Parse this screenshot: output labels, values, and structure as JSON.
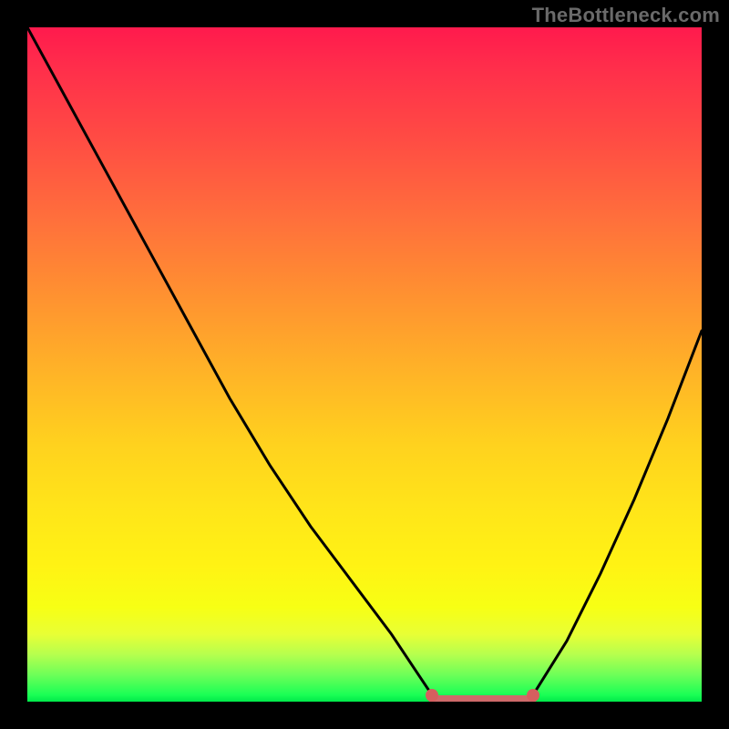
{
  "watermark": "TheBottleneck.com",
  "colors": {
    "background": "#000000",
    "watermark_text": "#6a6a6a",
    "curve_stroke": "#000000",
    "flat_segment": "#cf6a6a",
    "flat_dot": "#d65f5f"
  },
  "chart_data": {
    "type": "line",
    "title": "",
    "xlabel": "",
    "ylabel": "",
    "x_range": [
      0,
      100
    ],
    "y_range": [
      0,
      100
    ],
    "series": [
      {
        "name": "left-curve",
        "x": [
          0,
          6,
          12,
          18,
          24,
          30,
          36,
          42,
          48,
          54,
          58,
          60
        ],
        "y": [
          100,
          89,
          78,
          67,
          56,
          45,
          35,
          26,
          18,
          10,
          4,
          1
        ]
      },
      {
        "name": "flat-segment",
        "x": [
          60,
          75
        ],
        "y": [
          0,
          0
        ]
      },
      {
        "name": "right-curve",
        "x": [
          75,
          80,
          85,
          90,
          95,
          100
        ],
        "y": [
          1,
          9,
          19,
          30,
          42,
          55
        ]
      }
    ],
    "flat_segment_endpoints": {
      "x1": 60,
      "x2": 75,
      "y": 0
    }
  }
}
